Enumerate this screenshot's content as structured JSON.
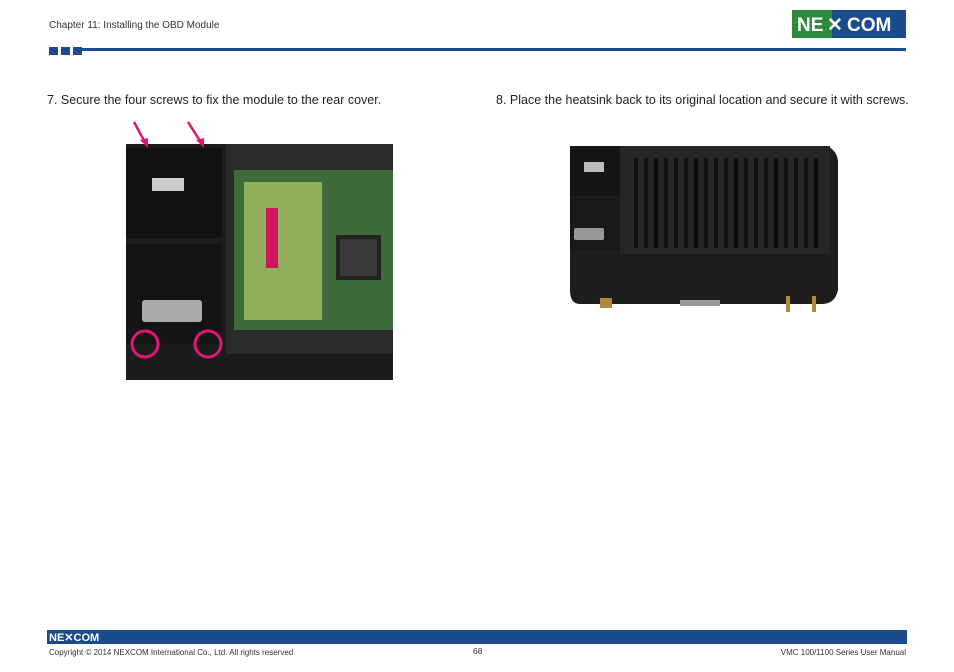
{
  "header": {
    "chapter": "Chapter 11: Installing the OBD Module",
    "logo_text": "NEXCOM"
  },
  "steps": [
    {
      "text": "7. Secure the four screws to fix the module to the rear cover."
    },
    {
      "text": "8.  Place the heatsink back to its original location and secure it with screws."
    }
  ],
  "colors": {
    "brand_blue": "#1a4b8c",
    "brand_green": "#2e8b3d",
    "highlight_magenta": "#e0157a"
  },
  "footer": {
    "logo_text": "NEXCOM",
    "copyright": "Copyright © 2014 NEXCOM International Co., Ltd. All rights reserved",
    "page": "68",
    "manual": "VMC 100/1100 Series User Manual"
  }
}
